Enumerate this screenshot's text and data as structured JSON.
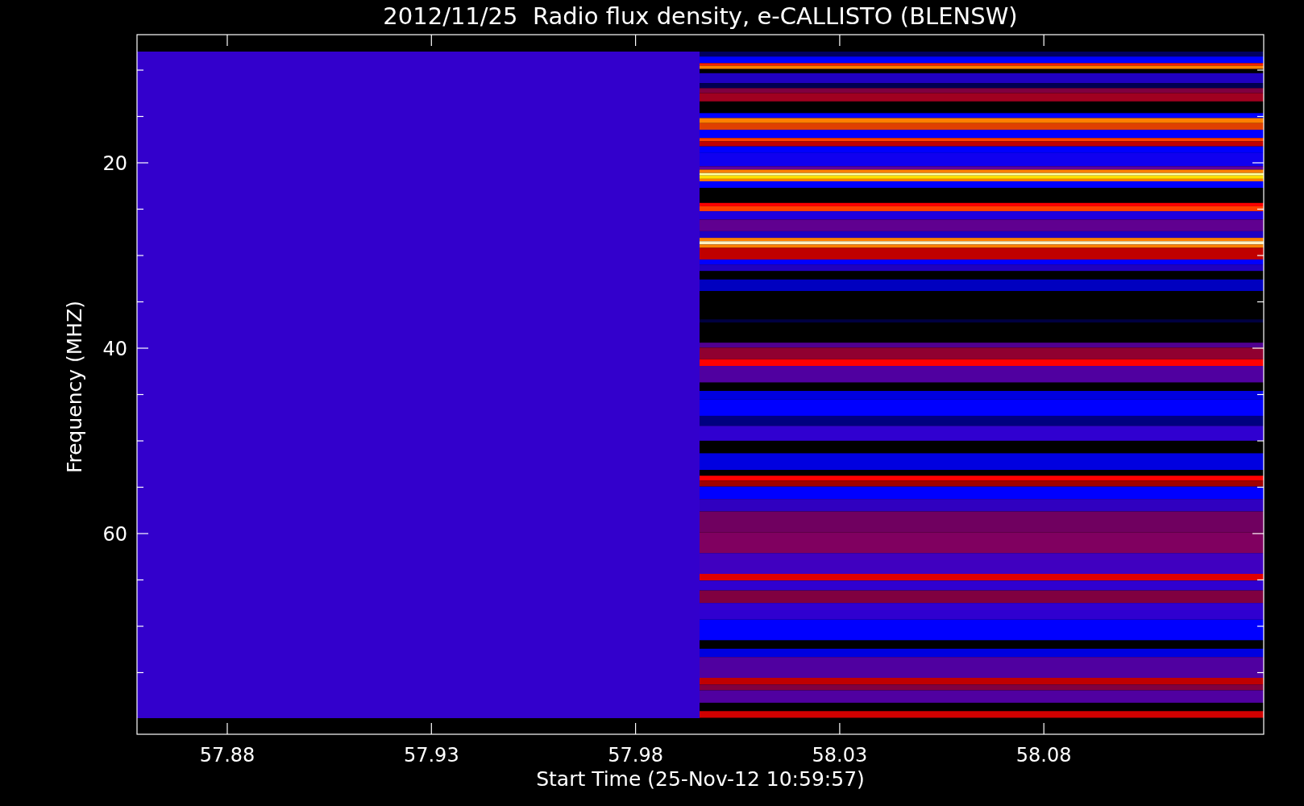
{
  "title": "2012/11/25  Radio flux density, e-CALLISTO (BLENSW)",
  "xlabel": "Start Time (25-Nov-12 10:59:57)",
  "ylabel": "Frequency (MHZ)",
  "xticks": [
    "57.88",
    "57.93",
    "57.98",
    "58.03",
    "58.08"
  ],
  "yticks": [
    "20",
    "40",
    "60"
  ]
}
